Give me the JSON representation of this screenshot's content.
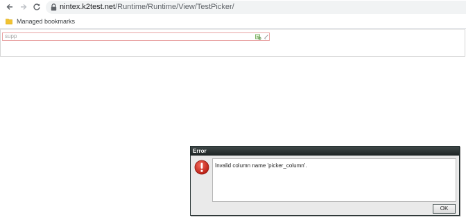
{
  "browser": {
    "address_bar": {
      "host": "nintex.k2test.net",
      "path": "/Runtime/Runtime/View/TestPicker/"
    },
    "bookmarks_bar": {
      "items": [
        {
          "label": "Managed bookmarks",
          "icon": "folder-icon"
        }
      ]
    }
  },
  "page": {
    "picker": {
      "value": "supp",
      "buttons": [
        "picker-lookup-icon",
        "picker-clear-icon"
      ]
    }
  },
  "dialog": {
    "title": "Error",
    "icon": "error-icon",
    "message": "Invalid column name 'picker_column'.",
    "ok_label": "OK"
  },
  "colors": {
    "dialog_title_bg": "#1d2424",
    "error_red": "#d42a1f",
    "picker_error_border": "#e8a0a0"
  }
}
